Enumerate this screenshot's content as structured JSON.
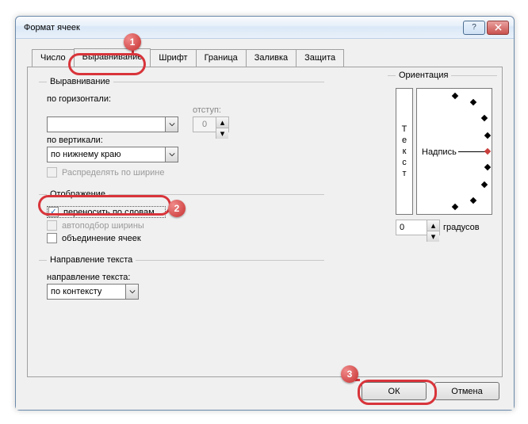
{
  "window": {
    "title": "Формат ячеек"
  },
  "tabs": {
    "items": [
      {
        "label": "Число"
      },
      {
        "label": "Выравнивание"
      },
      {
        "label": "Шрифт"
      },
      {
        "label": "Граница"
      },
      {
        "label": "Заливка"
      },
      {
        "label": "Защита"
      }
    ],
    "active_index": 1
  },
  "alignment": {
    "group_label": "Выравнивание",
    "horizontal_label": "по горизонтали:",
    "horizontal_value": "",
    "indent_label": "отступ:",
    "indent_value": "0",
    "vertical_label": "по вертикали:",
    "vertical_value": "по нижнему краю",
    "distribute_label": "Распределять по ширине"
  },
  "display": {
    "group_label": "Отображение",
    "wrap_label": "переносить по словам",
    "wrap_checked": true,
    "shrink_label": "автоподбор ширины",
    "merge_label": "объединение ячеек"
  },
  "textdir": {
    "group_label": "Направление текста",
    "dir_label": "направление текста:",
    "dir_value": "по контексту"
  },
  "orientation": {
    "group_label": "Ориентация",
    "vertical_text": "Текст",
    "dial_label": "Надпись",
    "degrees_value": "0",
    "degrees_label": "градусов"
  },
  "buttons": {
    "ok": "ОК",
    "cancel": "Отмена"
  },
  "annotations": {
    "n1": "1",
    "n2": "2",
    "n3": "3"
  }
}
